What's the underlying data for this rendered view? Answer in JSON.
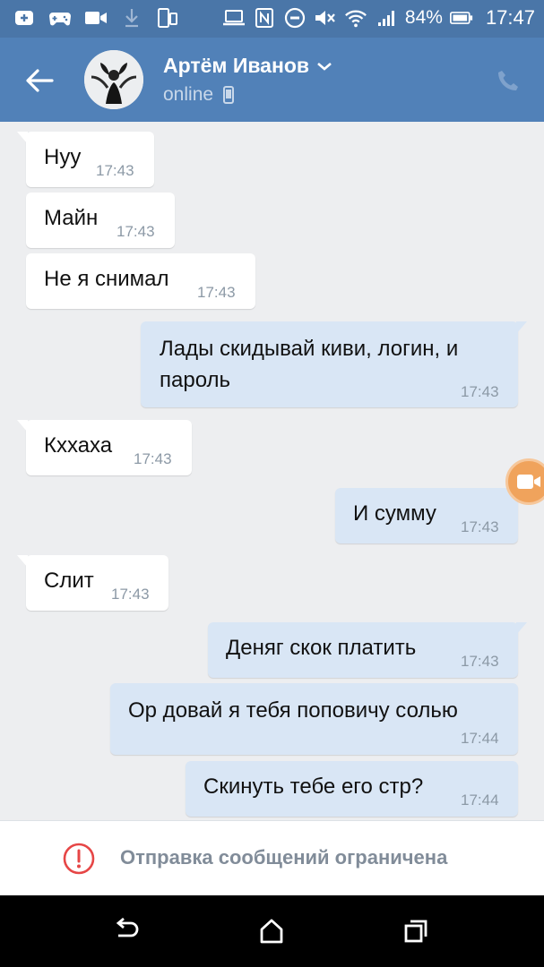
{
  "statusbar": {
    "battery": "84%",
    "time": "17:47",
    "icons": [
      "add-icon",
      "game-controller-icon",
      "video-camera-icon",
      "download-icon",
      "screen-mirror-icon",
      "laptop-icon",
      "nfc-icon",
      "do-not-disturb-icon",
      "mute-icon",
      "wifi-icon",
      "signal-icon",
      "battery-icon"
    ]
  },
  "header": {
    "name": "Артём Иванов",
    "status": "online",
    "colors": {
      "bar": "#5181b8",
      "status_bar": "#4a76a8"
    }
  },
  "messages": [
    {
      "dir": "in",
      "text": "Нуу",
      "time": "17:43"
    },
    {
      "dir": "in",
      "text": "Майн",
      "time": "17:43"
    },
    {
      "dir": "in",
      "text": "Не я снимал",
      "time": "17:43"
    },
    {
      "dir": "out",
      "text_line1": "Лады скидывай киви, логин, и",
      "text_line2": "пароль",
      "time": "17:43"
    },
    {
      "dir": "in",
      "text": "Кххаха",
      "time": "17:43"
    },
    {
      "dir": "out",
      "text": "И сумму",
      "time": "17:43"
    },
    {
      "dir": "in",
      "text": "Слит",
      "time": "17:43"
    },
    {
      "dir": "out",
      "text": "Деняг скок платить",
      "time": "17:43"
    },
    {
      "dir": "out",
      "text": "Ор довай я тебя поповичу солью",
      "time": "17:44"
    },
    {
      "dir": "out",
      "text": "Скинуть тебе его стр?",
      "time": "17:44"
    }
  ],
  "restriction": {
    "text": "Отправка сообщений ограничена",
    "icon": "alert-circle-icon",
    "color": "#e64646"
  },
  "navbar": {
    "icons": [
      "back-icon",
      "home-icon",
      "recents-icon"
    ]
  }
}
